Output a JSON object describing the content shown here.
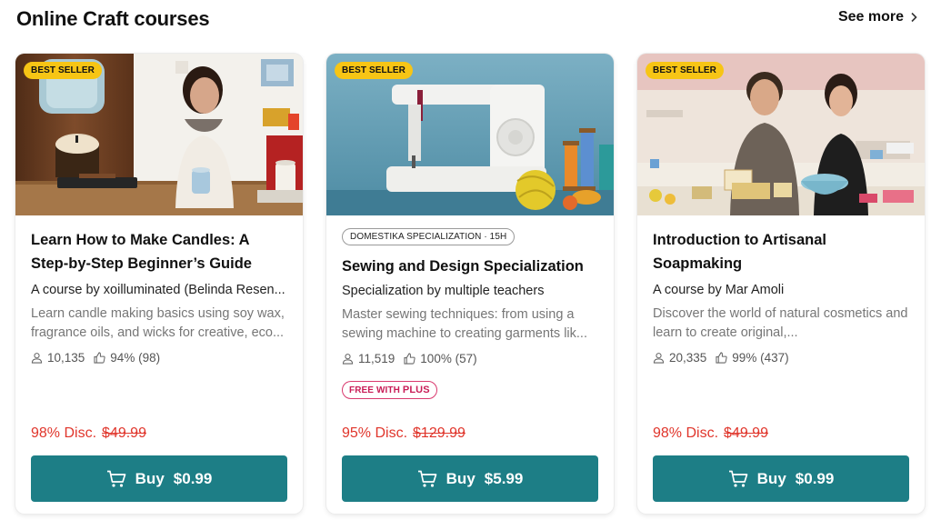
{
  "section": {
    "title": "Online Craft courses",
    "see_more": "See more"
  },
  "icons": {
    "see_more": "chevron-right-icon",
    "students": "user-icon",
    "rating": "thumbs-up-icon",
    "cart": "cart-icon"
  },
  "colors": {
    "accent": "#1d7e86",
    "discount": "#e0352b",
    "badge": "#f7c515",
    "plus": "#c81d57"
  },
  "cards": [
    {
      "badge": "BEST SELLER",
      "title": "Learn How to Make Candles: A Step-by-Step Beginner’s Guide",
      "byline": "A course by xoilluminated (Belinda Resen...",
      "description": "Learn candle making basics using soy wax, fragrance oils, and wicks for creative, eco...",
      "students": "10,135",
      "rating": "94% (98)",
      "discount": "98% Disc.",
      "old_price": "$49.99",
      "buy_label": "Buy",
      "price": "$0.99"
    },
    {
      "badge": "BEST SELLER",
      "spec_tag": "DOMESTIKA SPECIALIZATION · 15H",
      "title": "Sewing and Design Specialization",
      "byline": "Specialization by multiple teachers",
      "description": "Master sewing techniques: from using a sewing machine to creating garments lik...",
      "students": "11,519",
      "rating": "100% (57)",
      "plus_prefix": "FREE WITH",
      "plus_word": "PLUS",
      "discount": "95% Disc.",
      "old_price": "$129.99",
      "buy_label": "Buy",
      "price": "$5.99"
    },
    {
      "badge": "BEST SELLER",
      "title": "Introduction to Artisanal Soapmaking",
      "byline": "A course by Mar Amoli",
      "description": "Discover the world of natural cosmetics and learn to create original,...",
      "students": "20,335",
      "rating": "99% (437)",
      "discount": "98% Disc.",
      "old_price": "$49.99",
      "buy_label": "Buy",
      "price": "$0.99"
    }
  ]
}
